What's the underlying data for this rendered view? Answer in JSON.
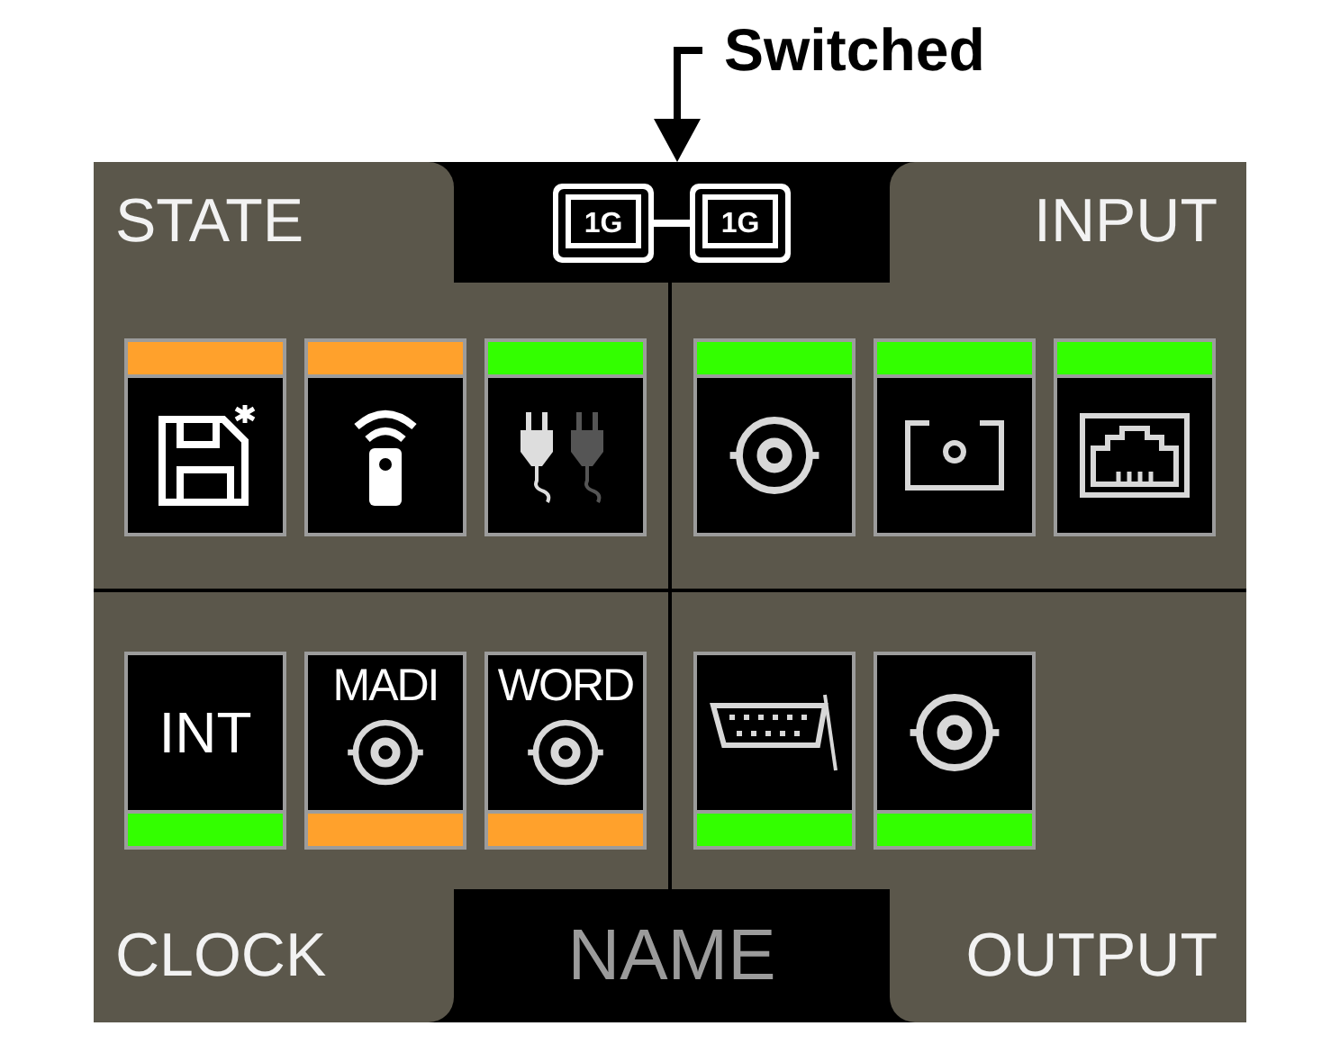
{
  "annotation": {
    "text": "Switched"
  },
  "top_center": {
    "ports": [
      {
        "label": "1G"
      },
      {
        "label": "1G"
      }
    ]
  },
  "quadrants": [
    {
      "label": "STATE",
      "tiles": [
        {
          "kind": "save",
          "color": "#ffa12c"
        },
        {
          "kind": "remote",
          "color": "#ffa12c"
        },
        {
          "kind": "power",
          "color": "#33ff00"
        }
      ]
    },
    {
      "label": "INPUT",
      "tiles": [
        {
          "kind": "bnc",
          "color": "#33ff00"
        },
        {
          "kind": "optical",
          "color": "#33ff00"
        },
        {
          "kind": "ethernet",
          "color": "#33ff00"
        }
      ]
    },
    {
      "label": "CLOCK",
      "tiles": [
        {
          "kind": "text",
          "text": "INT",
          "color": "#33ff00"
        },
        {
          "kind": "text_bnc",
          "text": "MADI",
          "color": "#ffa12c"
        },
        {
          "kind": "text_bnc",
          "text": "WORD",
          "color": "#ffa12c"
        }
      ]
    },
    {
      "label": "OUTPUT",
      "tiles": [
        {
          "kind": "dsub",
          "color": "#33ff00"
        },
        {
          "kind": "bnc",
          "color": "#33ff00"
        }
      ]
    }
  ],
  "bottom_center": {
    "text": "NAME"
  }
}
